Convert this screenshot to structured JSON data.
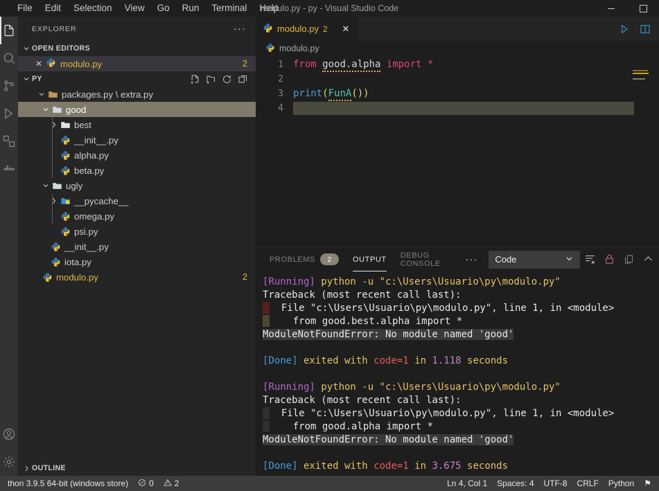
{
  "titlebar": {
    "menu": [
      "File",
      "Edit",
      "Selection",
      "View",
      "Go",
      "Run",
      "Terminal",
      "Help"
    ],
    "title": "modulo.py - py - Visual Studio Code",
    "window_controls": [
      "minimize",
      "maximize"
    ]
  },
  "activitybar": {
    "items": [
      {
        "name": "explorer",
        "icon": "files-icon",
        "active": true
      },
      {
        "name": "search",
        "icon": "search-icon",
        "active": false
      },
      {
        "name": "source-control",
        "icon": "source-control-icon",
        "active": false
      },
      {
        "name": "run-and-debug",
        "icon": "run-debug-icon",
        "active": false
      },
      {
        "name": "extensions",
        "icon": "extensions-icon",
        "active": false
      },
      {
        "name": "docker",
        "icon": "docker-icon",
        "active": false
      }
    ],
    "bottom_items": [
      {
        "name": "accounts",
        "icon": "account-icon"
      },
      {
        "name": "settings",
        "icon": "gear-icon"
      }
    ]
  },
  "sidebar": {
    "title": "EXPLORER",
    "more_actions": "···",
    "open_editors": {
      "label": "OPEN EDITORS",
      "chevron": "⌄",
      "items": [
        {
          "close": "✕",
          "icon": "python-icon",
          "name": "modulo.py",
          "badge": "2"
        }
      ]
    },
    "workspace": {
      "label": "PY",
      "chevron": "⌄",
      "actions": [
        "new-file-icon",
        "new-folder-icon",
        "refresh-icon",
        "collapse-all-icon"
      ]
    },
    "tree": [
      {
        "label": "packages.py \\ extra.py",
        "type": "folder",
        "depth": 1,
        "expanded": true,
        "selected": false,
        "badge": ""
      },
      {
        "label": "good",
        "type": "folder",
        "depth": 1,
        "expanded": true,
        "selected": true,
        "badge": ""
      },
      {
        "label": "best",
        "type": "folder",
        "depth": 2,
        "expanded": false,
        "selected": false,
        "badge": ""
      },
      {
        "label": "__init__.py",
        "type": "python",
        "depth": 2,
        "expanded": null,
        "selected": false,
        "badge": ""
      },
      {
        "label": "alpha.py",
        "type": "python",
        "depth": 2,
        "expanded": null,
        "selected": false,
        "badge": ""
      },
      {
        "label": "beta.py",
        "type": "python",
        "depth": 2,
        "expanded": null,
        "selected": false,
        "badge": ""
      },
      {
        "label": "ugly",
        "type": "folder",
        "depth": 1,
        "expanded": true,
        "selected": false,
        "badge": ""
      },
      {
        "label": "__pycache__",
        "type": "cachefolder",
        "depth": 2,
        "expanded": false,
        "selected": false,
        "badge": ""
      },
      {
        "label": "omega.py",
        "type": "python",
        "depth": 2,
        "expanded": null,
        "selected": false,
        "badge": ""
      },
      {
        "label": "psi.py",
        "type": "python",
        "depth": 2,
        "expanded": null,
        "selected": false,
        "badge": ""
      },
      {
        "label": "__init__.py",
        "type": "python",
        "depth": 1,
        "expanded": null,
        "selected": false,
        "badge": ""
      },
      {
        "label": "iota.py",
        "type": "python",
        "depth": 1,
        "expanded": null,
        "selected": false,
        "badge": ""
      },
      {
        "label": "modulo.py",
        "type": "python-modified",
        "depth": 0,
        "expanded": null,
        "selected": false,
        "badge": "2"
      }
    ],
    "outline": {
      "label": "OUTLINE",
      "chevron": "›"
    }
  },
  "editor": {
    "tab": {
      "icon": "python-icon",
      "name": "modulo.py",
      "count": "2",
      "close": "✕"
    },
    "tab_actions": [
      "run-python-file-icon",
      "split-editor-icon"
    ],
    "breadcrumb": {
      "icon": "python-icon",
      "text": "modulo.py"
    },
    "lines": [
      {
        "num": "1",
        "tokens": [
          {
            "t": "from",
            "c": "kw"
          },
          {
            "t": " ",
            "c": "plain"
          },
          {
            "t": "good.alpha",
            "c": "plain squig"
          },
          {
            "t": " ",
            "c": "plain"
          },
          {
            "t": "import",
            "c": "kw"
          },
          {
            "t": " ",
            "c": "plain"
          },
          {
            "t": "*",
            "c": "kw"
          }
        ]
      },
      {
        "num": "2",
        "tokens": []
      },
      {
        "num": "3",
        "tokens": [
          {
            "t": "print",
            "c": "call"
          },
          {
            "t": "(",
            "c": "paren"
          },
          {
            "t": "FunA",
            "c": "fn squig"
          },
          {
            "t": "()",
            "c": "paren"
          },
          {
            "t": ")",
            "c": "paren"
          }
        ]
      },
      {
        "num": "4",
        "tokens": []
      }
    ],
    "cursor_line": 4,
    "minimap_lines": [
      "#c8a415",
      "#b06030",
      "#7a8a40"
    ]
  },
  "panel": {
    "tabs": [
      {
        "label": "PROBLEMS",
        "badge": "2",
        "active": false
      },
      {
        "label": "OUTPUT",
        "badge": "",
        "active": true
      },
      {
        "label": "DEBUG CONSOLE",
        "badge": "",
        "active": false
      }
    ],
    "more": "···",
    "channel_select": {
      "value": "Code",
      "chevron": "⌄"
    },
    "actions": [
      "clear-output-icon",
      "lock-scroll-icon",
      "split-panel-icon",
      "maximize-panel-icon"
    ],
    "output_blocks": [
      {
        "running_tag": "[Running]",
        "command": " python -u \"c:\\Users\\Usuario\\py\\modulo.py\"",
        "traceback_header": "Traceback (most recent call last):",
        "file_line": "  File \"c:\\Users\\Usuario\\py\\modulo.py\", line 1, in <module>",
        "code_line": "    from good.best.alpha import *",
        "error_line": "ModuleNotFoundError: No module named 'good'",
        "done_tag": "[Done]",
        "done_prefix": " exited with ",
        "exit_code": "code=1",
        "done_mid": " in ",
        "duration": "1.118",
        "done_suffix": " seconds"
      },
      {
        "running_tag": "[Running]",
        "command": " python -u \"c:\\Users\\Usuario\\py\\modulo.py\"",
        "traceback_header": "Traceback (most recent call last):",
        "file_line": "  File \"c:\\Users\\Usuario\\py\\modulo.py\", line 1, in <module>",
        "code_line": "    from good.alpha import *",
        "error_line": "ModuleNotFoundError: No module named 'good'",
        "done_tag": "[Done]",
        "done_prefix": " exited with ",
        "exit_code": "code=1",
        "done_mid": " in ",
        "duration": "3.675",
        "done_suffix": " seconds"
      }
    ]
  },
  "statusbar": {
    "left": [
      {
        "name": "python-interpreter",
        "text": "thon 3.9.5 64-bit (windows store)"
      },
      {
        "name": "errors",
        "text": "0",
        "icon": "error-icon"
      },
      {
        "name": "warnings",
        "text": "2",
        "icon": "warning-icon"
      }
    ],
    "right": [
      {
        "name": "cursor-position",
        "text": "Ln 4, Col 1"
      },
      {
        "name": "indentation",
        "text": "Spaces: 4"
      },
      {
        "name": "encoding",
        "text": "UTF-8"
      },
      {
        "name": "line-endings",
        "text": "CRLF"
      },
      {
        "name": "language-mode",
        "text": "Python"
      },
      {
        "name": "notifications",
        "text": "⚑"
      }
    ]
  },
  "colors": {
    "accent_yellow": "#e2b93d",
    "selection": "#7f7a69",
    "activity_bar": "#333333",
    "sidebar_bg": "#252526",
    "editor_bg": "#1e1e1e",
    "status_bg": "#3c3c3c"
  }
}
